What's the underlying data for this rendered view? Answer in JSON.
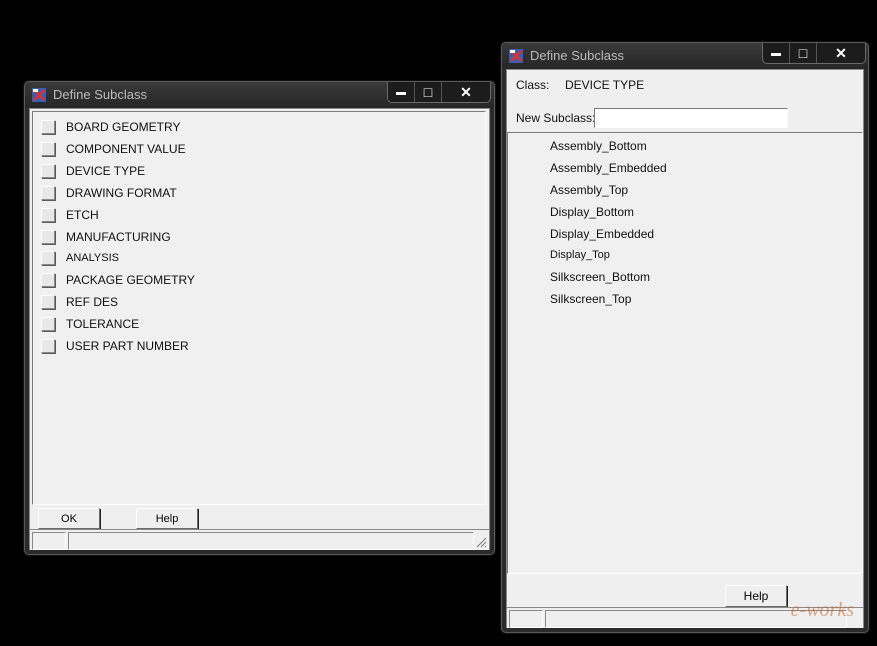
{
  "left_window": {
    "title": "Define Subclass",
    "controls": {
      "minimize": "▬",
      "maximize": "□",
      "close": "✕"
    },
    "items": [
      {
        "label": "BOARD GEOMETRY"
      },
      {
        "label": "COMPONENT VALUE"
      },
      {
        "label": "DEVICE TYPE"
      },
      {
        "label": "DRAWING FORMAT"
      },
      {
        "label": "ETCH"
      },
      {
        "label": "MANUFACTURING"
      },
      {
        "label": "ANALYSIS"
      },
      {
        "label": "PACKAGE GEOMETRY"
      },
      {
        "label": "REF DES"
      },
      {
        "label": "TOLERANCE"
      },
      {
        "label": "USER PART NUMBER"
      }
    ],
    "ok_label": "OK",
    "help_label": "Help"
  },
  "right_window": {
    "title": "Define Subclass",
    "controls": {
      "minimize": "▬",
      "maximize": "□",
      "close": "✕"
    },
    "class_label": "Class:",
    "class_value": "DEVICE TYPE",
    "new_subclass_label": "New Subclass:",
    "new_subclass_value": "",
    "subclasses": [
      "Assembly_Bottom",
      "Assembly_Embedded",
      "Assembly_Top",
      "Display_Bottom",
      "Display_Embedded",
      "Display_Top",
      "Silkscreen_Bottom",
      "Silkscreen_Top"
    ],
    "help_label": "Help"
  },
  "watermark": "e-works"
}
